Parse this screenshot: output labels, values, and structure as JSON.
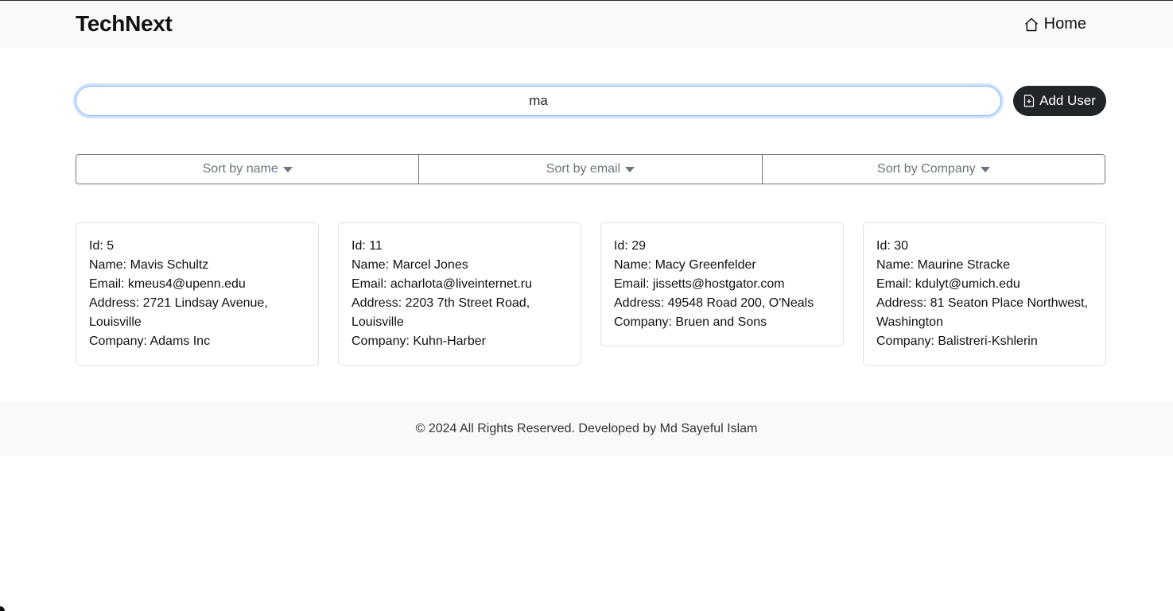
{
  "navbar": {
    "brand": "TechNext",
    "home_label": "Home",
    "home_icon": "house-icon"
  },
  "search": {
    "value": "ma",
    "placeholder": ""
  },
  "add_user": {
    "label": "Add User",
    "icon": "file-plus-icon"
  },
  "sort": {
    "items": [
      {
        "label": "Sort by name"
      },
      {
        "label": "Sort by email"
      },
      {
        "label": "Sort by Company"
      }
    ]
  },
  "users": [
    {
      "id": "Id: 5",
      "name": "Name: Mavis Schultz",
      "email": "Email: kmeus4@upenn.edu",
      "address": "Address: 2721 Lindsay Avenue, Louisville",
      "company": "Company: Adams Inc"
    },
    {
      "id": "Id: 11",
      "name": "Name: Marcel Jones",
      "email": "Email: acharlota@liveinternet.ru",
      "address": "Address: 2203 7th Street Road, Louisville",
      "company": "Company: Kuhn-Harber"
    },
    {
      "id": "Id: 29",
      "name": "Name: Macy Greenfelder",
      "email": "Email: jissetts@hostgator.com",
      "address": "Address: 49548 Road 200, O'Neals",
      "company": "Company: Bruen and Sons"
    },
    {
      "id": "Id: 30",
      "name": "Name: Maurine Stracke",
      "email": "Email: kdulyt@umich.edu",
      "address": "Address: 81 Seaton Place Northwest, Washington",
      "company": "Company: Balistreri-Kshlerin"
    }
  ],
  "footer": {
    "text": "© 2024 All Rights Reserved. Developed by Md Sayeful Islam"
  }
}
